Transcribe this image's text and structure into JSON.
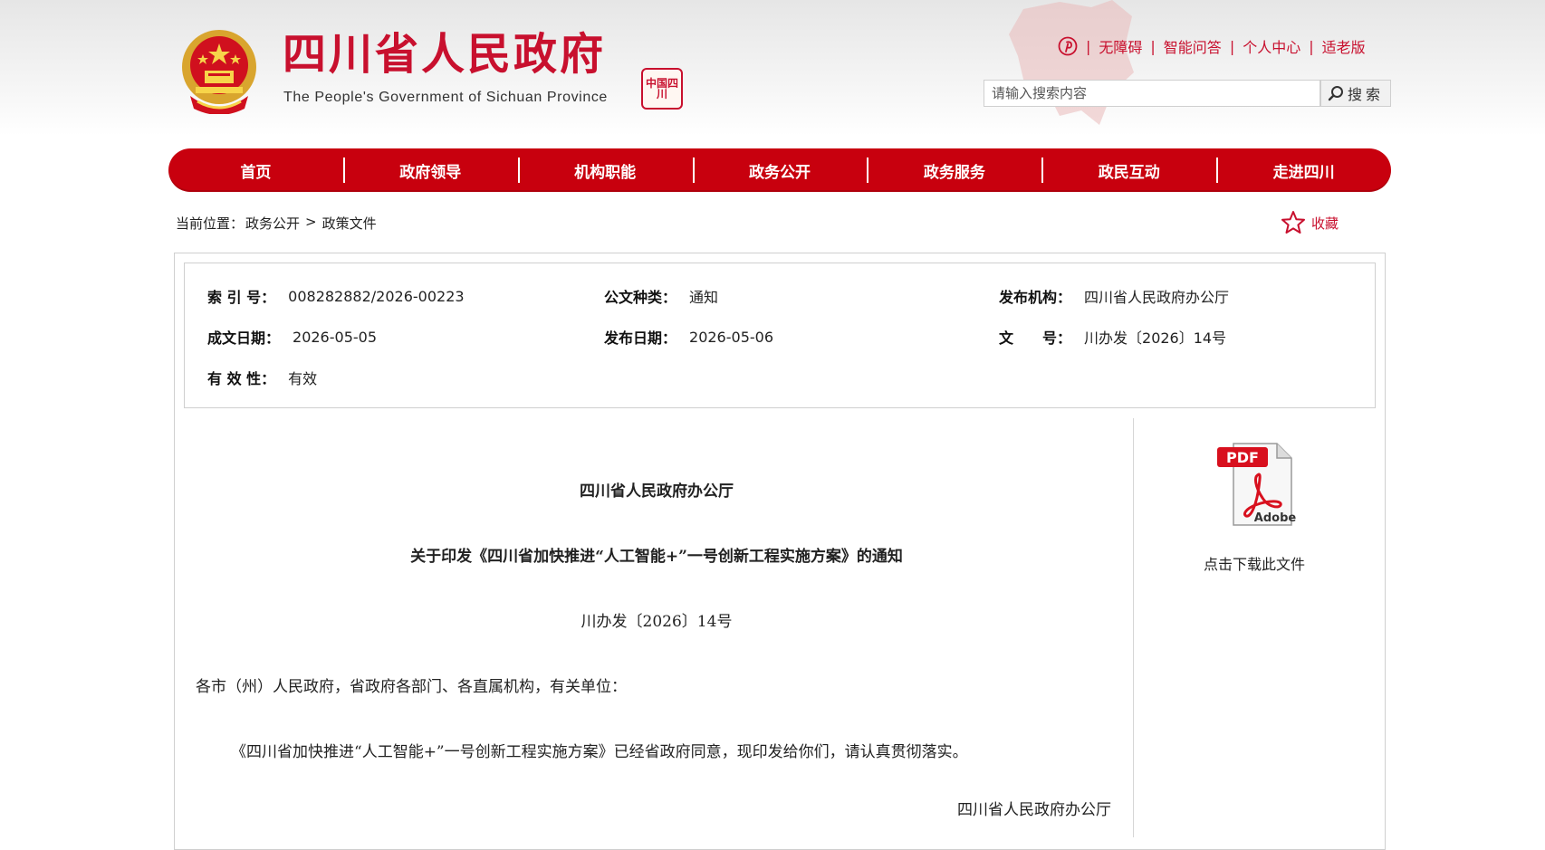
{
  "header": {
    "site_title": "四川省人民政府",
    "site_subtitle": "The People's Government of Sichuan Province",
    "seal_text": "中国四川",
    "brand_color": "#c8102e",
    "top_links": [
      "无障碍",
      "智能问答",
      "个人中心",
      "适老版"
    ],
    "search": {
      "placeholder": "请输入搜索内容",
      "value": "",
      "button_label": "搜索"
    }
  },
  "nav": {
    "items": [
      "首页",
      "政府领导",
      "机构职能",
      "政务公开",
      "政务服务",
      "政民互动",
      "走进四川"
    ],
    "bar_color": "#c8000e"
  },
  "breadcrumb": {
    "prefix": "当前位置：",
    "items": [
      "政务公开",
      "政策文件"
    ],
    "separator": ">"
  },
  "favorite_label": "收藏",
  "meta": {
    "index_label": "索 引 号：",
    "index_value": "008282882/2026-00223",
    "type_label": "公文种类：",
    "type_value": "通知",
    "org_label": "发布机构：",
    "org_value": "四川省人民政府办公厅",
    "created_label": "成文日期：",
    "created_value": "2026-05-05",
    "published_label": "发布日期：",
    "published_value": "2026-05-06",
    "docno_label": "文　　号：",
    "docno_value": "川办发〔2026〕14号",
    "validity_label": "有 效 性：",
    "validity_value": "有效"
  },
  "document": {
    "issuer": "四川省人民政府办公厅",
    "title": "关于印发《四川省加快推进“人工智能+”一号创新工程实施方案》的通知",
    "doc_number": "川办发〔2026〕14号",
    "salutation": "各市（州）人民政府，省政府各部门、各直属机构，有关单位：",
    "body": "《四川省加快推进“人工智能+”一号创新工程实施方案》已经省政府同意，现印发给你们，请认真贯彻落实。",
    "signature": "四川省人民政府办公厅"
  },
  "download": {
    "pdf_badge": "PDF",
    "adobe_label": "Adobe",
    "label": "点击下载此文件"
  }
}
